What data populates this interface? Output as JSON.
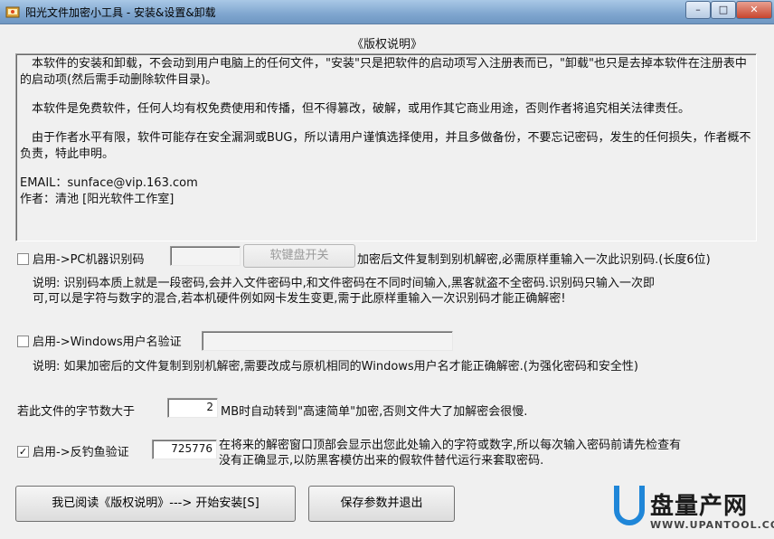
{
  "window": {
    "title": "阳光文件加密小工具 - 安装&设置&卸载",
    "min_label": "–",
    "max_label": "□",
    "close_label": "✕"
  },
  "copyright": {
    "heading": "《版权说明》",
    "paragraphs": [
      "　本软件的安装和卸载，不会动到用户电脑上的任何文件，\"安装\"只是把软件的启动项写入注册表而已，\"卸载\"也只是去掉本软件在注册表中的启动项(然后需手动删除软件目录)。",
      "　本软件是免费软件，任何人均有权免费使用和传播，但不得篡改，破解，或用作其它商业用途，否则作者将追究相关法律责任。",
      "　由于作者水平有限，软件可能存在安全漏洞或BUG，所以请用户谨慎选择使用，并且多做备份，不要忘记密码，发生的任何损失，作者概不负责，特此申明。"
    ],
    "email": "EMAIL：sunface@vip.163.com",
    "author": "作者：清池 [阳光软件工作室]"
  },
  "pc_id": {
    "checked": false,
    "label": "启用->PC机器识别码",
    "value": "",
    "keyboard_button": "软键盘开关",
    "hint": "加密后文件复制到别机解密,必需原样重输入一次此识别码.(长度6位)",
    "note_line1": "说明: 识别码本质上就是一段密码,会并入文件密码中,和文件密码在不同时间输入,黑客就盗不全密码.识别码只输入一次即",
    "note_line2": "可,可以是字符与数字的混合,若本机硬件例如网卡发生变更,需于此原样重输入一次识别码才能正确解密!"
  },
  "win_user": {
    "checked": false,
    "label": "启用->Windows用户名验证",
    "value": "",
    "note": "说明: 如果加密后的文件复制到别机解密,需要改成与原机相同的Windows用户名才能正确解密.(为强化密码和安全性)"
  },
  "size_limit": {
    "label": "若此文件的字节数大于",
    "value": "2",
    "suffix": "MB时自动转到\"高速简单\"加密,否则文件大了加解密会很慢."
  },
  "anti_phish": {
    "checked": true,
    "check_mark": "✓",
    "label": "启用->反钓鱼验证",
    "value": "725776",
    "desc_line1": "在将来的解密窗口顶部会显示出您此处输入的字符或数字,所以每次输入密码前请先检查有",
    "desc_line2": "没有正确显示,以防黑客模仿出来的假软件替代运行来套取密码."
  },
  "buttons": {
    "install": "我已阅读《版权说明》---> 开始安装[S]",
    "save_exit": "保存参数并退出"
  },
  "watermark": {
    "brand": "盘量产网",
    "url": "WWW.UPANTOOL.COM"
  },
  "colors": {
    "accent": "#1f86d8",
    "titlebar": "#7fa6cf",
    "window_bg": "#f0f0f0"
  }
}
